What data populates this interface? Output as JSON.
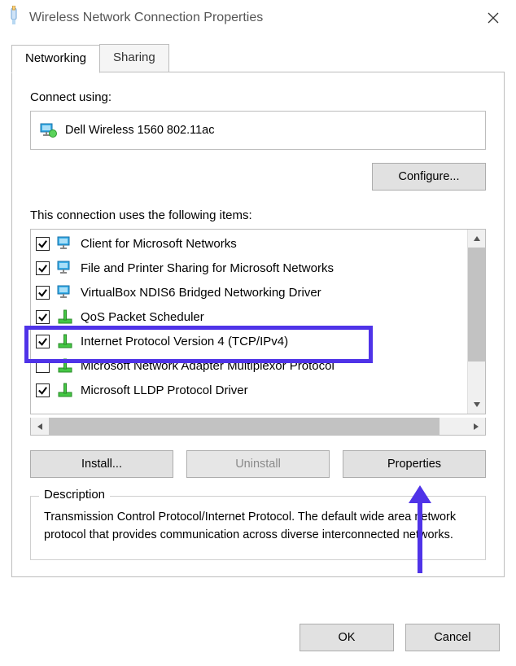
{
  "window": {
    "title": "Wireless Network Connection Properties"
  },
  "tabs": {
    "networking": "Networking",
    "sharing": "Sharing"
  },
  "connect_using_label": "Connect using:",
  "adapter_name": "Dell Wireless 1560 802.11ac",
  "configure_label": "Configure...",
  "items_label": "This connection uses the following items:",
  "items": [
    {
      "checked": true,
      "icon": "monitor",
      "label": "Client for Microsoft Networks"
    },
    {
      "checked": true,
      "icon": "monitor",
      "label": "File and Printer Sharing for Microsoft Networks"
    },
    {
      "checked": true,
      "icon": "monitor",
      "label": "VirtualBox NDIS6 Bridged Networking Driver"
    },
    {
      "checked": true,
      "icon": "protocol",
      "label": "QoS Packet Scheduler",
      "cut": true
    },
    {
      "checked": true,
      "icon": "protocol",
      "label": "Internet Protocol Version 4 (TCP/IPv4)"
    },
    {
      "checked": false,
      "icon": "protocol",
      "label": "Microsoft Network Adapter Multiplexor Protocol",
      "cut2": true
    },
    {
      "checked": true,
      "icon": "protocol",
      "label": "Microsoft LLDP Protocol Driver"
    }
  ],
  "buttons": {
    "install": "Install...",
    "uninstall": "Uninstall",
    "properties": "Properties",
    "ok": "OK",
    "cancel": "Cancel"
  },
  "description": {
    "legend": "Description",
    "text": "Transmission Control Protocol/Internet Protocol. The default wide area network protocol that provides communication across diverse interconnected networks."
  },
  "annotation": {
    "highlight_color": "#4f33e8",
    "arrow_color": "#4f33e8"
  }
}
